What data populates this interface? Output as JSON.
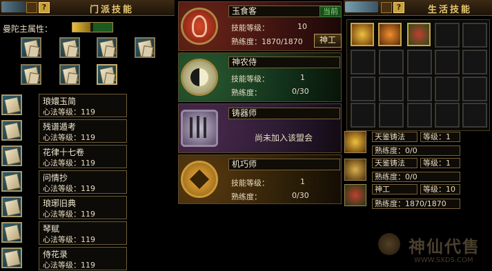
{
  "left_panel": {
    "title": "门派技能",
    "help_label": "?",
    "attribute_label": "曼陀主属性：",
    "skills": [
      {
        "name": "琅嬛玉简",
        "level": "心法等级：119"
      },
      {
        "name": "残谱遁考",
        "level": "心法等级：119"
      },
      {
        "name": "花律十七卷",
        "level": "心法等级：119"
      },
      {
        "name": "问情抄",
        "level": "心法等级：119"
      },
      {
        "name": "琅琊旧典",
        "level": "心法等级：119"
      },
      {
        "name": "琴赋",
        "level": "心法等级：119"
      },
      {
        "name": "侍花录",
        "level": "心法等级：119"
      }
    ]
  },
  "middle_panel": {
    "professions": [
      {
        "name": "玉食客",
        "badge": "当前",
        "level_label": "技能等级：",
        "level_value": "10",
        "prof_label": "熟练度：1870/1870",
        "button": "神工",
        "emblem_icon": "dragon-emblem-icon"
      },
      {
        "name": "神农侍",
        "level_label": "技能等级：",
        "level_value": "1",
        "prof_label": "熟练度：",
        "prof_value": "0/30",
        "emblem_icon": "yin-yang-emblem-icon"
      },
      {
        "name": "铸器师",
        "status": "尚未加入该盟会",
        "emblem_icon": "weapon-rack-emblem-icon"
      },
      {
        "name": "机巧师",
        "level_label": "技能等级：",
        "level_value": "1",
        "prof_label": "熟练度：",
        "prof_value": "0/30",
        "emblem_icon": "gear-emblem-icon"
      }
    ]
  },
  "right_panel": {
    "title": "生活技能",
    "help_label": "?",
    "life_skills": [
      {
        "name": "天鉴铸法",
        "level": "等级：1",
        "prof": "熟练度：0/0"
      },
      {
        "name": "天鉴铸法",
        "level": "等级：1",
        "prof": "熟练度：0/0"
      },
      {
        "name": "神工",
        "level": "等级：10",
        "prof": "熟练度：1870/1870"
      }
    ]
  },
  "watermark": {
    "text": "神仙代售",
    "url": "WWW.SXDS.COM"
  },
  "colors": {
    "gold": "#e8c872",
    "current_badge": "#7ce07c",
    "prof1_bg": "#3a1210",
    "prof2_bg": "#12301a",
    "prof3_bg": "#2a1a30",
    "prof4_bg": "#2e2008"
  }
}
